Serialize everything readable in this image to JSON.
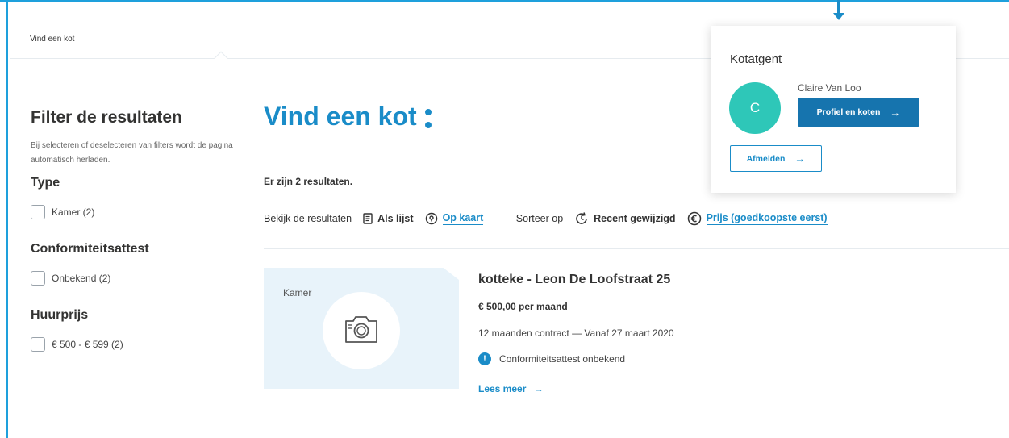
{
  "breadcrumb": "Vind een kot",
  "filters": {
    "title": "Filter de resultaten",
    "note": "Bij selecteren of deselecteren van filters wordt de pagina automatisch herladen.",
    "groups": [
      {
        "title": "Type",
        "options": [
          {
            "label": "Kamer (2)",
            "checked": false
          }
        ]
      },
      {
        "title": "Conformiteitsattest",
        "options": [
          {
            "label": "Onbekend (2)",
            "checked": false
          }
        ]
      },
      {
        "title": "Huurprijs",
        "options": [
          {
            "label": "€ 500 - € 599 (2)",
            "checked": false
          }
        ]
      }
    ]
  },
  "main": {
    "title": "Vind een kot",
    "results_count": "Er zijn 2 resultaten.",
    "view_bar": {
      "view_label": "Bekijk de resultaten",
      "list_label": "Als lijst",
      "map_label": "Op kaart",
      "separator": "—",
      "sort_label": "Sorteer op",
      "recent_label": "Recent gewijzigd",
      "price_label": "Prijs (goedkoopste eerst)"
    }
  },
  "listing": {
    "tag": "Kamer",
    "title": "kotteke - Leon De Loofstraat 25",
    "price": "€ 500,00 per maand",
    "contract": "12 maanden contract — Vanaf 27 maart 2020",
    "certificate": "Conformiteitsattest onbekend",
    "read_more": "Lees meer"
  },
  "user_popup": {
    "title": "Kotatgent",
    "avatar_initial": "C",
    "user_name": "Claire Van Loo",
    "profile_button": "Profiel en koten",
    "logout_button": "Afmelden"
  },
  "colors": {
    "accent": "#1a8cc8",
    "button_primary": "#1674ae",
    "avatar": "#2ec7b8",
    "image_bg": "#e8f3fa",
    "frame": "#1ea0dc"
  },
  "icons": {
    "list": "document-list-icon",
    "map": "map-pin-icon",
    "recent": "clock-refresh-icon",
    "price": "euro-icon",
    "camera": "camera-icon",
    "info": "info-icon",
    "arrow": "arrow-right-icon"
  }
}
